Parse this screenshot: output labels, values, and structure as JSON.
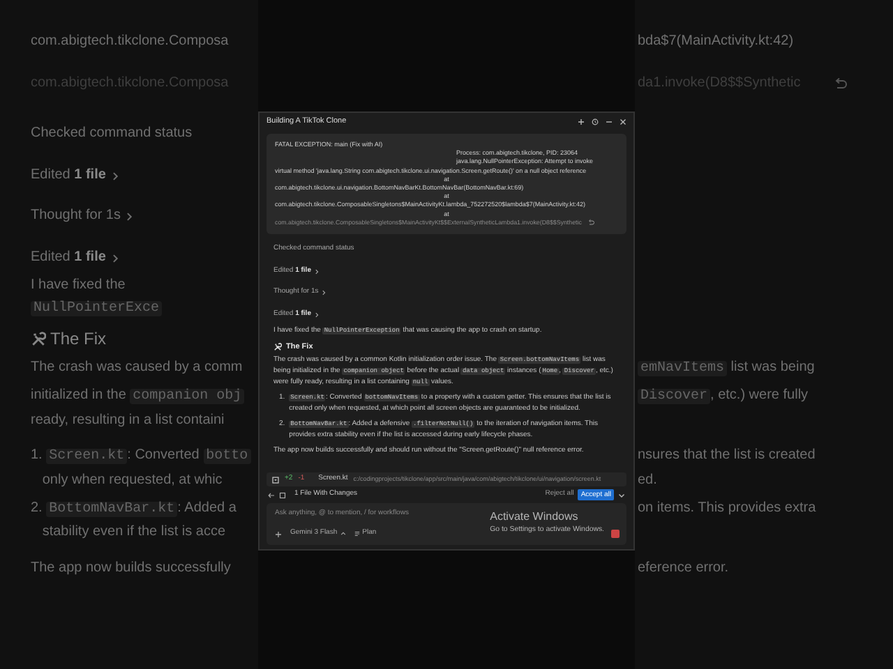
{
  "background": {
    "rows": [
      {
        "kind": "text",
        "left": [
          {
            "kind": "text",
            "text": "com.abigtech.tikclone.Composa"
          }
        ],
        "right": [
          {
            "kind": "text",
            "text": "bda$7(MainActivity.kt:42)"
          }
        ]
      },
      {
        "kind": "text",
        "faded": true,
        "undo_button": true,
        "left": [
          {
            "kind": "text",
            "text": "com.abigtech.tikclone.Composa"
          }
        ],
        "right": [
          {
            "kind": "text",
            "text": "da1.invoke(D8$$Synthetic"
          }
        ]
      },
      {
        "kind": "step",
        "left": [
          {
            "kind": "text",
            "text": "Checked command status"
          }
        ]
      },
      {
        "kind": "step",
        "expandable": true,
        "left": [
          {
            "kind": "text",
            "text": "Edited **1 file**"
          }
        ]
      },
      {
        "kind": "step",
        "expandable": true,
        "left": [
          {
            "kind": "text",
            "text": "Thought for 1s"
          }
        ]
      },
      {
        "kind": "step",
        "expandable": true,
        "left": [
          {
            "kind": "text",
            "text": "Edited **1 file**"
          }
        ]
      },
      {
        "kind": "text",
        "left": [
          {
            "kind": "text",
            "text": "I have fixed the "
          },
          {
            "kind": "code",
            "text": "NullPointerExce"
          }
        ]
      },
      {
        "kind": "heading",
        "left": [
          {
            "kind": "text",
            "text": "The Fix"
          }
        ]
      },
      {
        "kind": "text",
        "left": [
          {
            "kind": "text",
            "text": "The crash was caused by a comm"
          }
        ],
        "right": [
          {
            "kind": "code",
            "text": "emNavItems"
          },
          {
            "kind": "text",
            "text": " list was being"
          }
        ]
      },
      {
        "kind": "text",
        "left": [
          {
            "kind": "text",
            "text": "initialized in the "
          },
          {
            "kind": "code",
            "text": "companion obj"
          }
        ],
        "right": [
          {
            "kind": "code",
            "text": "Discover"
          },
          {
            "kind": "text",
            "text": ", etc.) were fully"
          }
        ]
      },
      {
        "kind": "text",
        "left": [
          {
            "kind": "text",
            "text": "ready, resulting in a list containi"
          }
        ]
      },
      {
        "kind": "text",
        "left": [
          {
            "kind": "text",
            "text": "1. "
          },
          {
            "kind": "code",
            "text": "Screen.kt"
          },
          {
            "kind": "text",
            "text": ": Converted "
          },
          {
            "kind": "code",
            "text": "botto"
          }
        ],
        "right": [
          {
            "kind": "text",
            "text": "nsures that the list is created"
          }
        ]
      },
      {
        "kind": "text",
        "left": [
          {
            "kind": "text",
            "text": "   only when requested, at whic"
          }
        ],
        "right": [
          {
            "kind": "text",
            "text": "ed."
          }
        ]
      },
      {
        "kind": "text",
        "left": [
          {
            "kind": "text",
            "text": "2. "
          },
          {
            "kind": "code",
            "text": "BottomNavBar.kt"
          },
          {
            "kind": "text",
            "text": ": Added a"
          }
        ],
        "right": [
          {
            "kind": "text",
            "text": "on items. This provides extra"
          }
        ]
      },
      {
        "kind": "text",
        "left": [
          {
            "kind": "text",
            "text": "   stability even if the list is acce"
          }
        ]
      },
      {
        "kind": "text",
        "left": [
          {
            "kind": "text",
            "text": "The app now builds successfully"
          }
        ],
        "right": [
          {
            "kind": "text",
            "text": "eference error."
          }
        ]
      }
    ]
  },
  "panel": {
    "title": "Building A TikTok Clone",
    "error": {
      "lines": [
        {
          "text": "FATAL EXCEPTION: main (Fix with AI)",
          "kind": "header"
        },
        {
          "text": "Process: com.abigtech.tikclone, PID: 23064",
          "kind": "detail"
        },
        {
          "text": "java.lang.NullPointerException: Attempt to invoke",
          "kind": "detail"
        },
        {
          "text": "virtual method 'java.lang.String com.abigtech.tikclone.ui.navigation.Screen.getRoute()' on a null object reference",
          "kind": "header"
        },
        {
          "text": "at",
          "kind": "at"
        },
        {
          "text": "com.abigtech.tikclone.ui.navigation.BottomNavBarKt.BottomNavBar(BottomNavBar.kt:69)",
          "kind": "header"
        },
        {
          "text": "at",
          "kind": "at"
        },
        {
          "text": "com.abigtech.tikclone.ComposableSingletons$MainActivityKt.lambda_752272520$lambda$7(MainActivity.kt:42)",
          "kind": "header"
        },
        {
          "text": "at",
          "kind": "at"
        }
      ],
      "faded_line": "com.abigtech.tikclone.ComposableSingletons$MainActivityKt$$ExternalSyntheticLambda1.invoke(D8$$Synthetic"
    },
    "steps": [
      {
        "text": "Checked command status",
        "expandable": false
      },
      {
        "text": "Edited **1 file**",
        "expandable": true
      },
      {
        "text": "Thought for 1s",
        "expandable": true
      },
      {
        "text": "Edited **1 file**",
        "expandable": true
      }
    ],
    "intro": [
      {
        "kind": "text",
        "text": "I have fixed the "
      },
      {
        "kind": "code",
        "text": "NullPointerException"
      },
      {
        "kind": "text",
        "text": " that was causing the app to crash on startup."
      }
    ],
    "heading": "The Fix",
    "paragraph": [
      {
        "kind": "text",
        "text": "The crash was caused by a common Kotlin initialization order issue. The "
      },
      {
        "kind": "code",
        "text": "Screen.bottomNavItems"
      },
      {
        "kind": "text",
        "text": " list was being initialized in the "
      },
      {
        "kind": "code",
        "text": "companion object"
      },
      {
        "kind": "text",
        "text": " before the actual "
      },
      {
        "kind": "code",
        "text": "data object"
      },
      {
        "kind": "text",
        "text": " instances ("
      },
      {
        "kind": "code",
        "text": "Home"
      },
      {
        "kind": "text",
        "text": ", "
      },
      {
        "kind": "code",
        "text": "Discover"
      },
      {
        "kind": "text",
        "text": ", etc.) were fully ready, resulting in a list containing "
      },
      {
        "kind": "code",
        "text": "null"
      },
      {
        "kind": "text",
        "text": " values."
      }
    ],
    "fixes": [
      {
        "number": "1.",
        "segments": [
          {
            "kind": "code",
            "text": "Screen.kt"
          },
          {
            "kind": "text",
            "text": ": Converted "
          },
          {
            "kind": "code",
            "text": "bottomNavItems"
          },
          {
            "kind": "text",
            "text": " to a property with a custom getter. This ensures that the list is created only when requested, at which point all screen objects are guaranteed to be initialized."
          }
        ]
      },
      {
        "number": "2.",
        "segments": [
          {
            "kind": "code",
            "text": "BottomNavBar.kt"
          },
          {
            "kind": "text",
            "text": ": Added a defensive "
          },
          {
            "kind": "code",
            "text": ".filterNotNull()"
          },
          {
            "kind": "text",
            "text": " to the iteration of navigation items. This provides extra stability even if the list is accessed during early lifecycle phases."
          }
        ]
      }
    ],
    "conclusion": "The app now builds successfully and should run without the \"Screen.getRoute()\" null reference error.",
    "file_bar": {
      "added": "+2",
      "removed": "-1",
      "file": "Screen.kt",
      "path": "c:/codingprojects/tikclone/app/src/main/java/com/abigtech/tikclone/ui/navigation/screen.kt"
    },
    "changes": {
      "label": "1 File With Changes",
      "reject": "Reject all",
      "accept": "Accept all"
    },
    "composer": {
      "placeholder": "Ask anything, @ to mention, / for workflows",
      "model": "Gemini 3 Flash",
      "mode": "Plan"
    },
    "activation": {
      "title": "Activate Windows",
      "subtitle": "Go to Settings to activate Windows."
    }
  }
}
